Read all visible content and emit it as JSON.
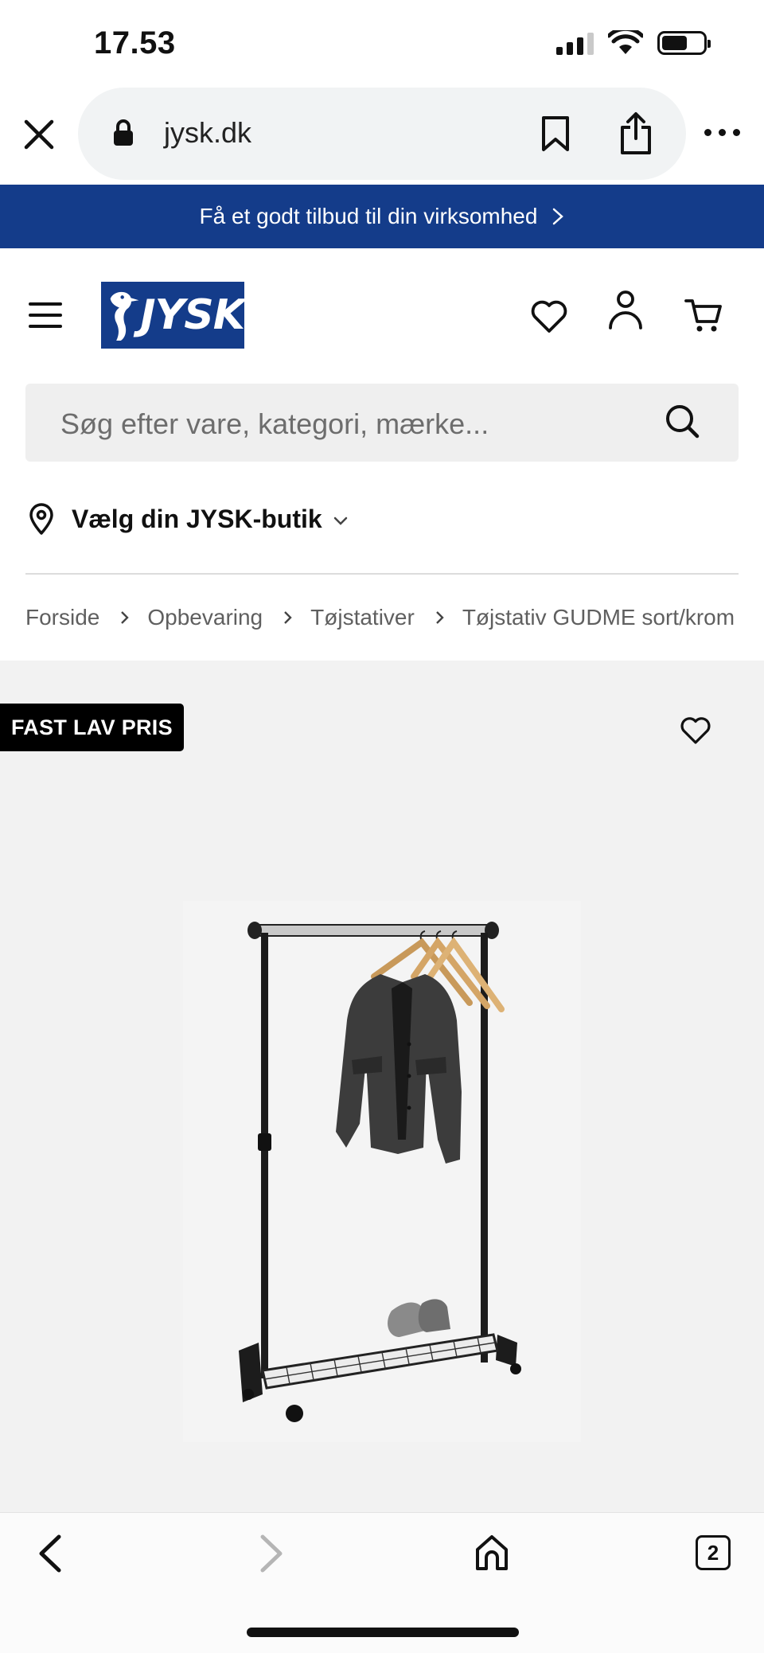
{
  "status_bar": {
    "time": "17.53"
  },
  "browser": {
    "url": "jysk.dk",
    "open_tabs": "2"
  },
  "promo": {
    "text": "Få et godt tilbud til din virksomhed"
  },
  "header": {
    "logo_text": "JYSK",
    "brand_color": "#143c8a"
  },
  "search": {
    "placeholder": "Søg efter vare, kategori, mærke..."
  },
  "store": {
    "label": "Vælg din JYSK-butik"
  },
  "breadcrumb": {
    "items": [
      "Forside",
      "Opbevaring",
      "Tøjstativer",
      "Tøjstativ GUDME sort/krom"
    ]
  },
  "product": {
    "badge": "FAST LAV PRIS",
    "image_subject": "clothes rack with jacket on hangers and shoes on bottom shelf"
  }
}
